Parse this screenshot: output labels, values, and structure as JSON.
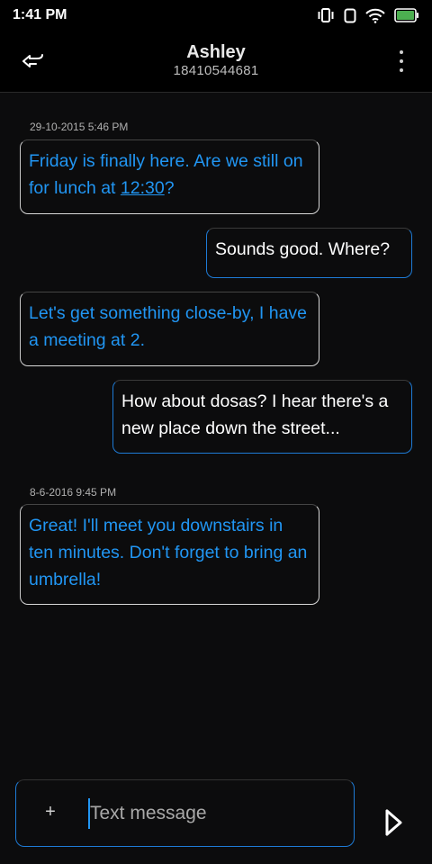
{
  "status_bar": {
    "time": "1:41 PM",
    "icons": [
      "vibrate-icon",
      "sim-icon",
      "wifi-icon",
      "battery-icon"
    ],
    "battery_color": "#4caf50"
  },
  "header": {
    "contact_name": "Ashley",
    "contact_number": "18410544681",
    "icons": [
      "back-icon",
      "more-vert-icon"
    ]
  },
  "messages": {
    "timestamp_1": "29-10-2015 5:46 PM",
    "m1": {
      "text_before": "Friday is finally here. Are we still on for lunch at ",
      "link": "12:30",
      "text_after": "?"
    },
    "m2": "Sounds good. Where?",
    "m3": "Let's get something close-by, I have a meeting at 2.",
    "m4": "How about dosas? I hear there's a new place down the street...",
    "timestamp_2": "8-6-2016 9:45 PM",
    "m5": "Great! I'll meet you downstairs in ten minutes. Don't forget to bring an umbrella!"
  },
  "compose": {
    "attach_label": "+",
    "placeholder": "Text message",
    "value": ""
  },
  "colors": {
    "incoming_text": "#2196f3",
    "outgoing_border": "#1e7bd6",
    "background": "#0c0c0d"
  }
}
